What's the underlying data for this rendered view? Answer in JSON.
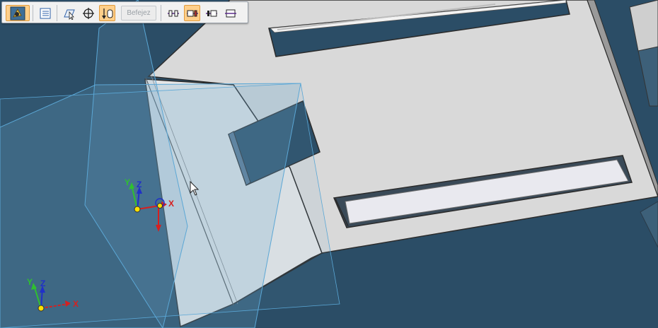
{
  "toolbar": {
    "logo_icon": "part-view-icon",
    "buttons": [
      {
        "icon": "properties-list-icon",
        "active": false
      },
      {
        "icon": "select-plane-icon",
        "active": false
      },
      {
        "icon": "keypoint-target-icon",
        "active": false
      },
      {
        "icon": "side-direction-icon",
        "active": true
      }
    ],
    "finish_label": "Befejez",
    "finish_enabled": false,
    "align_buttons": [
      {
        "icon": "align-both-sides-icon",
        "active": false
      },
      {
        "icon": "align-right-icon",
        "active": true
      },
      {
        "icon": "align-left-icon",
        "active": false
      },
      {
        "icon": "align-center-icon",
        "active": false
      }
    ]
  },
  "triad_part": {
    "x": "X",
    "y": "Y",
    "z": "Z"
  },
  "triad_base": {
    "x": "X",
    "y": "Y",
    "z": "Z"
  },
  "colors": {
    "background": "#2b4d66",
    "part_face": "#dcdcdc",
    "plane_edge": "#5aa7d6",
    "axis_x": "#d62020",
    "axis_y": "#2fc02f",
    "axis_z": "#2030c8",
    "toolbar_active": "#ffcf8a"
  }
}
